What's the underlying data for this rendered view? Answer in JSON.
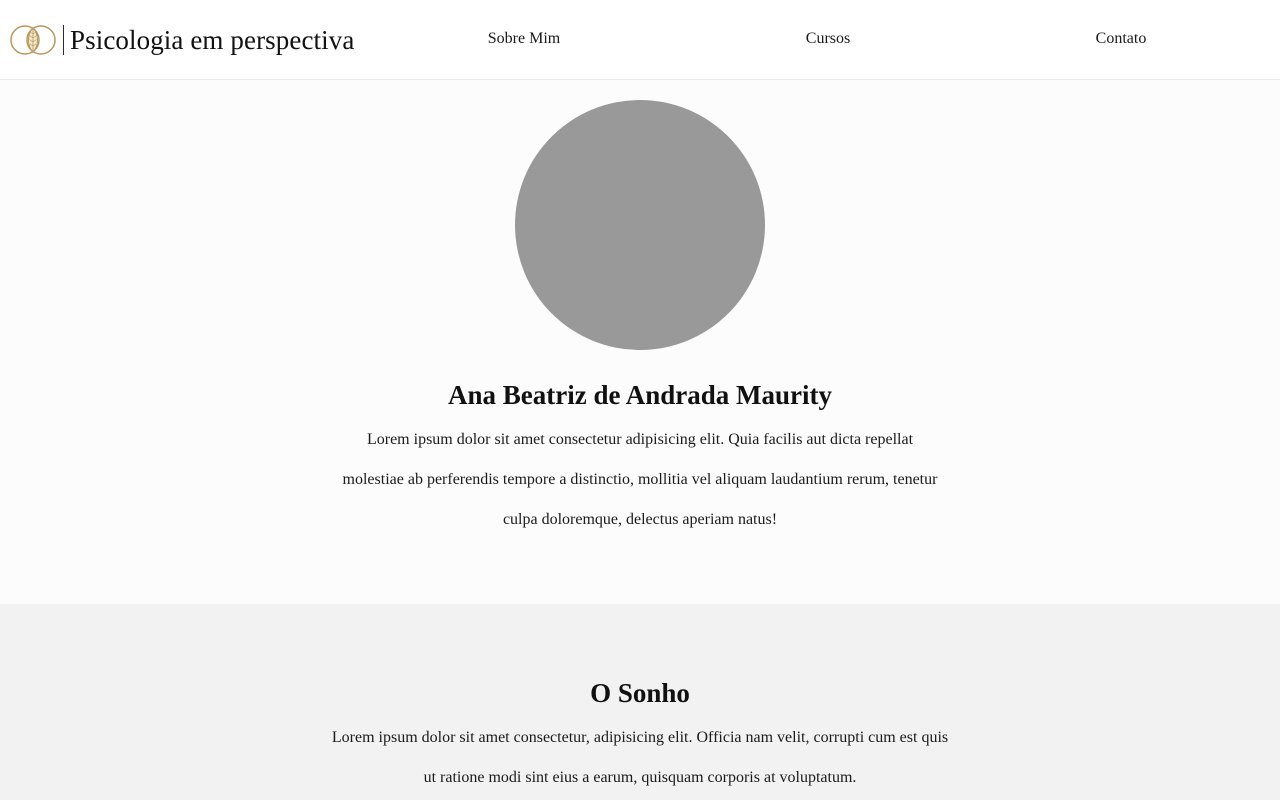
{
  "header": {
    "brand_name": "Psicologia em perspectiva",
    "logo_icon": "interlocking-rings-leaf-icon",
    "accent_color": "#b8975a",
    "nav": [
      {
        "label": "Sobre Mim"
      },
      {
        "label": "Cursos"
      },
      {
        "label": "Contato"
      }
    ]
  },
  "profile": {
    "avatar_color": "#999999",
    "name": "Ana Beatriz de Andrada Maurity",
    "bio": "Lorem ipsum dolor sit amet consectetur adipisicing elit. Quia facilis aut dicta repellat molestiae ab perferendis tempore a distinctio, mollitia vel aliquam laudantium rerum, tenetur culpa doloremque, delectus aperiam natus!"
  },
  "dream": {
    "title": "O Sonho",
    "text": "Lorem ipsum dolor sit amet consectetur, adipisicing elit. Officia nam velit, corrupti cum est quis ut ratione modi sint eius a earum, quisquam corporis at voluptatum."
  }
}
